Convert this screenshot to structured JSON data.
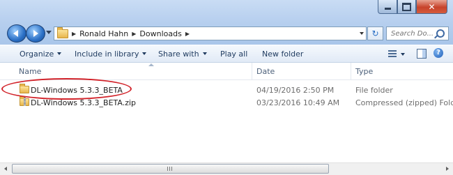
{
  "address_bar": {
    "crumbs": [
      "Ronald Hahn",
      "Downloads"
    ],
    "search_placeholder": "Search Do..."
  },
  "toolbar": {
    "organize": "Organize",
    "include_in_library": "Include in library",
    "share_with": "Share with",
    "play_all": "Play all",
    "new_folder": "New folder"
  },
  "columns": {
    "name": "Name",
    "date": "Date",
    "type": "Type"
  },
  "files": [
    {
      "name": "DL-Windows 5.3.3_BETA",
      "date": "04/19/2016 2:50 PM",
      "type": "File folder",
      "icon": "folder-icon"
    },
    {
      "name": "DL-Windows 5.3.3_BETA.zip",
      "date": "03/23/2016 10:49 AM",
      "type": "Compressed (zipped) Folder",
      "icon": "zip-folder-icon"
    }
  ],
  "colors": {
    "highlight": "#d2232a",
    "close_button": "#c7432b"
  }
}
